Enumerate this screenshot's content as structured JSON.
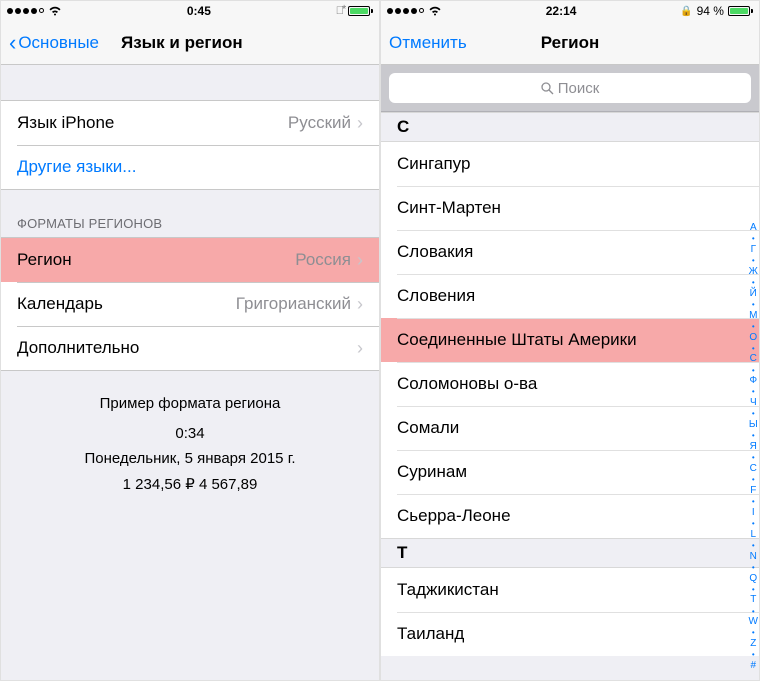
{
  "left": {
    "status": {
      "time": "0:45",
      "bluetooth": true,
      "signal_filled": 4
    },
    "nav": {
      "back": "Основные",
      "title": "Язык и регион"
    },
    "rows": {
      "iphone_lang_label": "Язык iPhone",
      "iphone_lang_value": "Русский",
      "other_langs": "Другие языки...",
      "section_header": "ФОРМАТЫ РЕГИОНОВ",
      "region_label": "Регион",
      "region_value": "Россия",
      "calendar_label": "Календарь",
      "calendar_value": "Григорианский",
      "advanced": "Дополнительно"
    },
    "preview": {
      "title": "Пример формата региона",
      "time": "0:34",
      "date": "Понедельник, 5 января 2015 г.",
      "numbers": "1 234,56 ₽      4 567,89"
    }
  },
  "right": {
    "status": {
      "time": "22:14",
      "battery_pct": "94 %",
      "signal_filled": 4
    },
    "nav": {
      "cancel": "Отменить",
      "title": "Регион"
    },
    "search_placeholder": "Поиск",
    "sections": [
      {
        "letter": "С",
        "items": [
          "Сингапур",
          "Синт-Мартен",
          "Словакия",
          "Словения",
          "Соединенные Штаты Америки",
          "Соломоновы о-ва",
          "Сомали",
          "Суринам",
          "Сьерра-Леоне"
        ],
        "highlight_index": 4
      },
      {
        "letter": "Т",
        "items": [
          "Таджикистан",
          "Таиланд"
        ]
      }
    ],
    "index_letters": [
      "А",
      "•",
      "Г",
      "•",
      "Ж",
      "•",
      "Й",
      "•",
      "М",
      "•",
      "О",
      "•",
      "С",
      "•",
      "Ф",
      "•",
      "Ч",
      "•",
      "Ы",
      "•",
      "Я",
      "•",
      "C",
      "•",
      "F",
      "•",
      "I",
      "•",
      "L",
      "•",
      "N",
      "•",
      "Q",
      "•",
      "T",
      "•",
      "W",
      "•",
      "Z",
      "•",
      "#"
    ]
  }
}
